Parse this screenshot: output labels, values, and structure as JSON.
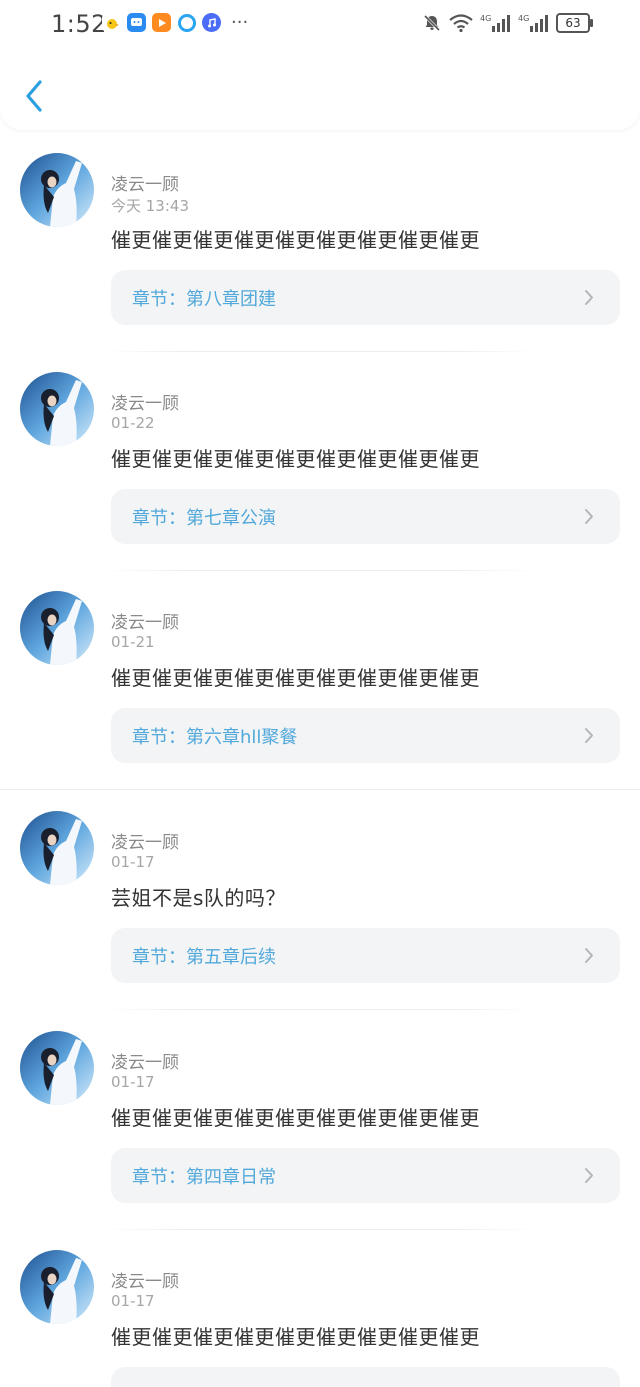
{
  "status_bar": {
    "time": "1:52",
    "battery": "63",
    "network_label_1": "4G",
    "network_label_2": "4G"
  },
  "colors": {
    "accent": "#2b9fe0",
    "chapter_text": "#52a8da",
    "card_bg": "#f3f4f6"
  },
  "comments": [
    {
      "username": "凌云一顾",
      "date": "今天 13:43",
      "text": "催更催更催更催更催更催更催更催更催更",
      "chapter": "章节：第八章团建"
    },
    {
      "username": "凌云一顾",
      "date": "01-22",
      "text": "催更催更催更催更催更催更催更催更催更",
      "chapter": "章节：第七章公演"
    },
    {
      "username": "凌云一顾",
      "date": "01-21",
      "text": "催更催更催更催更催更催更催更催更催更",
      "chapter": "章节：第六章hll聚餐"
    },
    {
      "username": "凌云一顾",
      "date": "01-17",
      "text": "芸姐不是s队的吗？",
      "chapter": "章节：第五章后续"
    },
    {
      "username": "凌云一顾",
      "date": "01-17",
      "text": "催更催更催更催更催更催更催更催更催更",
      "chapter": "章节：第四章日常"
    },
    {
      "username": "凌云一顾",
      "date": "01-17",
      "text": "催更催更催更催更催更催更催更催更催更",
      "chapter": ""
    }
  ]
}
